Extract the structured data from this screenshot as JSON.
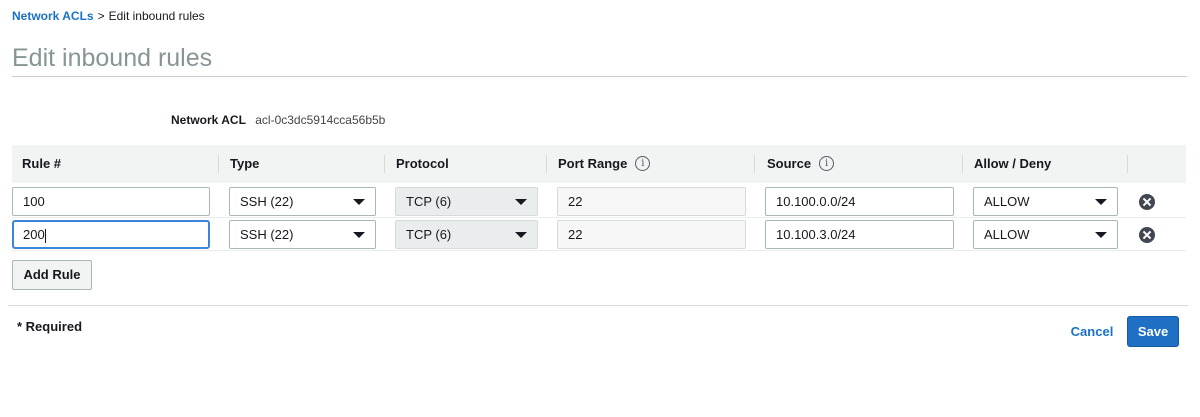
{
  "breadcrumb": {
    "link": "Network ACLs",
    "separator": ">",
    "current": "Edit inbound rules"
  },
  "page_title": "Edit inbound rules",
  "acl": {
    "label": "Network ACL",
    "value": "acl-0c3dc5914cca56b5b"
  },
  "columns": {
    "rule": "Rule #",
    "type": "Type",
    "protocol": "Protocol",
    "port_range": "Port Range",
    "source": "Source",
    "allow_deny": "Allow / Deny"
  },
  "rules": [
    {
      "rule": "100",
      "type": "SSH (22)",
      "protocol": "TCP (6)",
      "port_range": "22",
      "source": "10.100.0.0/24",
      "action": "ALLOW"
    },
    {
      "rule": "200",
      "type": "SSH (22)",
      "protocol": "TCP (6)",
      "port_range": "22",
      "source": "10.100.3.0/24",
      "action": "ALLOW"
    }
  ],
  "icons": {
    "info": "info-icon",
    "remove": "remove-circle-icon",
    "dropdown": "caret-down-icon"
  },
  "buttons": {
    "add_rule": "Add Rule",
    "cancel": "Cancel",
    "save": "Save"
  },
  "footer": {
    "required": "* Required"
  },
  "colors": {
    "link": "#1a72c4",
    "primary_button": "#1f6fc4",
    "focus_border": "#3b86d8"
  }
}
